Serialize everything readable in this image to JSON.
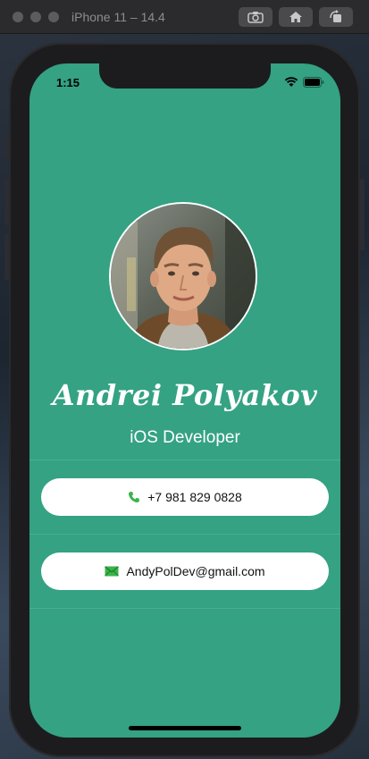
{
  "simulator": {
    "title": "iPhone 11 – 14.4",
    "icons": [
      "screenshot-icon",
      "home-icon",
      "rotate-icon"
    ]
  },
  "status_bar": {
    "time": "1:15",
    "icons": [
      "wifi-icon",
      "battery-icon"
    ]
  },
  "profile": {
    "name": "Andrei Polyakov",
    "role": "iOS Developer"
  },
  "contacts": {
    "phone": "+7 981 829 0828",
    "email": "AndyPolDev@gmail.com"
  },
  "colors": {
    "background": "#34a283",
    "card": "#ffffff",
    "phone_icon": "#3ab54a",
    "email_icon": "#3ab54a"
  }
}
